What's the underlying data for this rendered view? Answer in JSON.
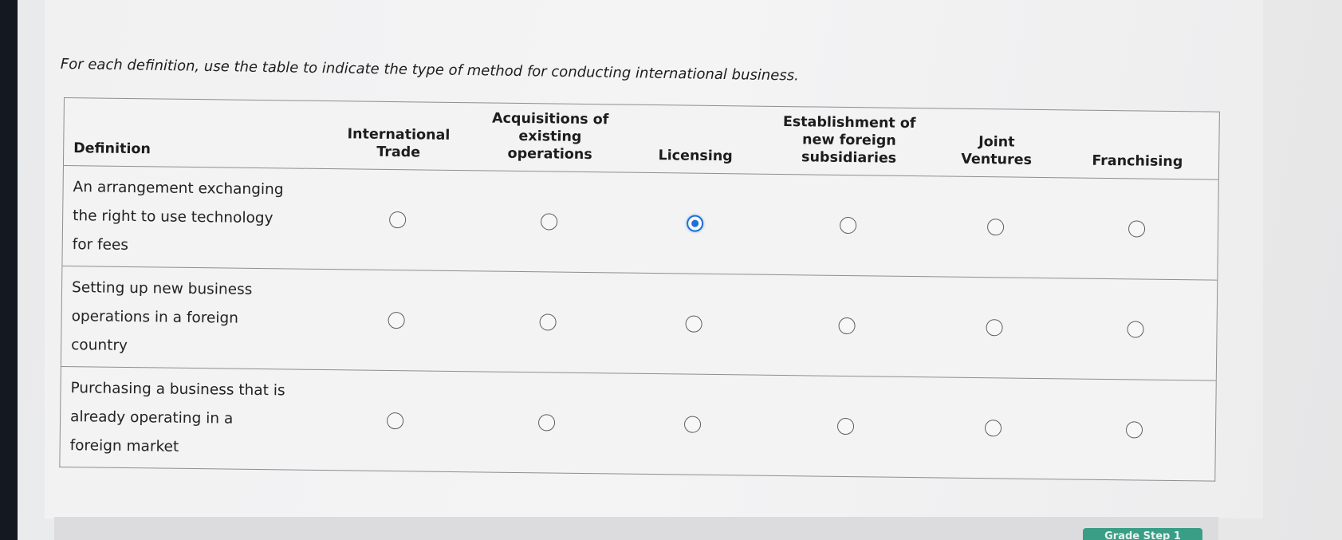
{
  "instruction": "For each definition, use the table to indicate the type of method for conducting international business.",
  "table": {
    "headers": [
      "Definition",
      "International Trade",
      "Acquisitions of existing operations",
      "Licensing",
      "Establishment of new foreign subsidiaries",
      "Joint Ventures",
      "Franchising"
    ],
    "rows": [
      {
        "definition": "An arrangement exchanging\nthe right to use technology\nfor fees",
        "selected": "Licensing"
      },
      {
        "definition": "Setting up new business\noperations in a foreign\ncountry",
        "selected": null
      },
      {
        "definition": "Purchasing a business that is\nalready operating in a\nforeign market",
        "selected": null
      }
    ]
  },
  "footer": {
    "grade_button_label": "Grade Step 1"
  },
  "colors": {
    "radio_selected": "#1f6fd6",
    "grade_button": "#3a9d86"
  }
}
